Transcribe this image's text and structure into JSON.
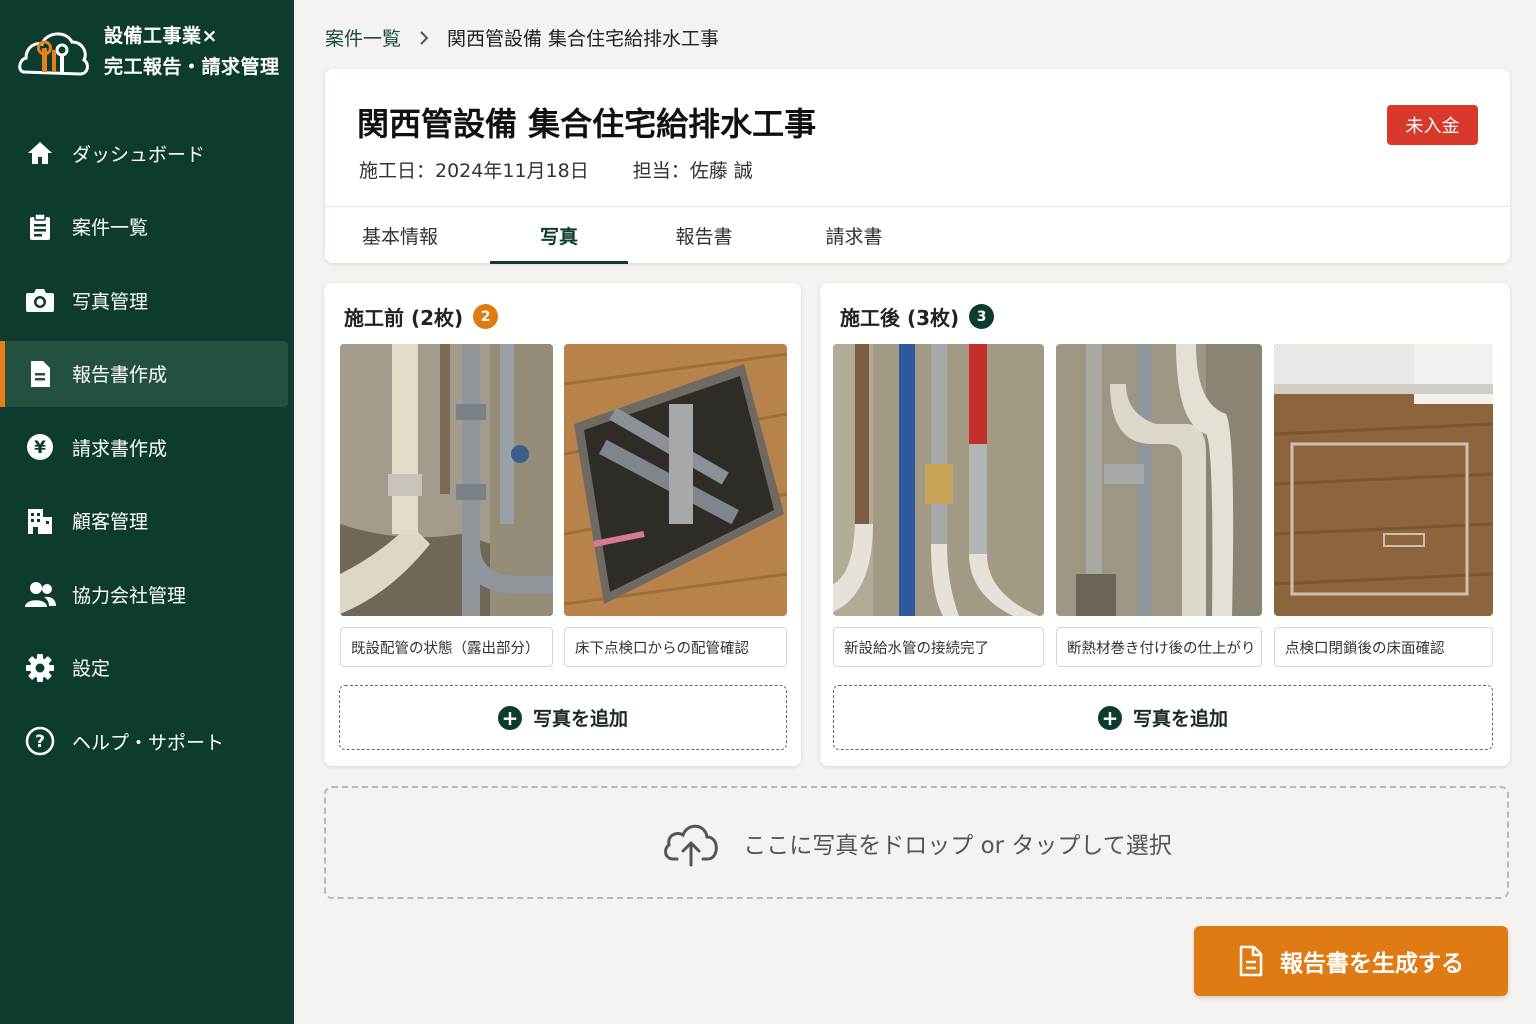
{
  "brand": {
    "line1": "設備工事業×",
    "line2": "完工報告・請求管理"
  },
  "nav": [
    {
      "label": "ダッシュボード",
      "icon": "home-icon"
    },
    {
      "label": "案件一覧",
      "icon": "clipboard-icon"
    },
    {
      "label": "写真管理",
      "icon": "camera-icon"
    },
    {
      "label": "報告書作成",
      "icon": "document-icon",
      "active": true
    },
    {
      "label": "請求書作成",
      "icon": "yen-icon"
    },
    {
      "label": "顧客管理",
      "icon": "building-icon"
    },
    {
      "label": "協力会社管理",
      "icon": "people-icon"
    },
    {
      "label": "設定",
      "icon": "gear-icon"
    },
    {
      "label": "ヘルプ・サポート",
      "icon": "help-icon"
    }
  ],
  "breadcrumb": {
    "parent": "案件一覧",
    "current": "関西管設備 集合住宅給排水工事"
  },
  "job": {
    "title": "関西管設備 集合住宅給排水工事",
    "date": "施工日：2024年11月18日",
    "assignee": "担当：佐藤 誠",
    "status": "未入金"
  },
  "tabs": [
    {
      "label": "基本情報"
    },
    {
      "label": "写真",
      "active": true
    },
    {
      "label": "報告書"
    },
    {
      "label": "請求書"
    }
  ],
  "before": {
    "title": "施工前 (2枚)",
    "count": "2",
    "captions": [
      "既設配管の状態（露出部分）",
      "床下点検口からの配管確認"
    ],
    "add_label": "写真を追加"
  },
  "after": {
    "title": "施工後 (3枚)",
    "count": "3",
    "captions": [
      "新設給水管の接続完了",
      "断熱材巻き付け後の仕上がり",
      "点検口閉鎖後の床面確認"
    ],
    "add_label": "写真を追加"
  },
  "dropzone": {
    "label": "ここに写真をドロップ or タップして選択"
  },
  "generate": {
    "label": "報告書を生成する"
  },
  "colors": {
    "sidebar": "#0d3b2f",
    "accent": "#e07b13",
    "status_unpaid": "#d9392b",
    "before_badge": "#e07b13",
    "after_badge": "#0d3b2f"
  }
}
